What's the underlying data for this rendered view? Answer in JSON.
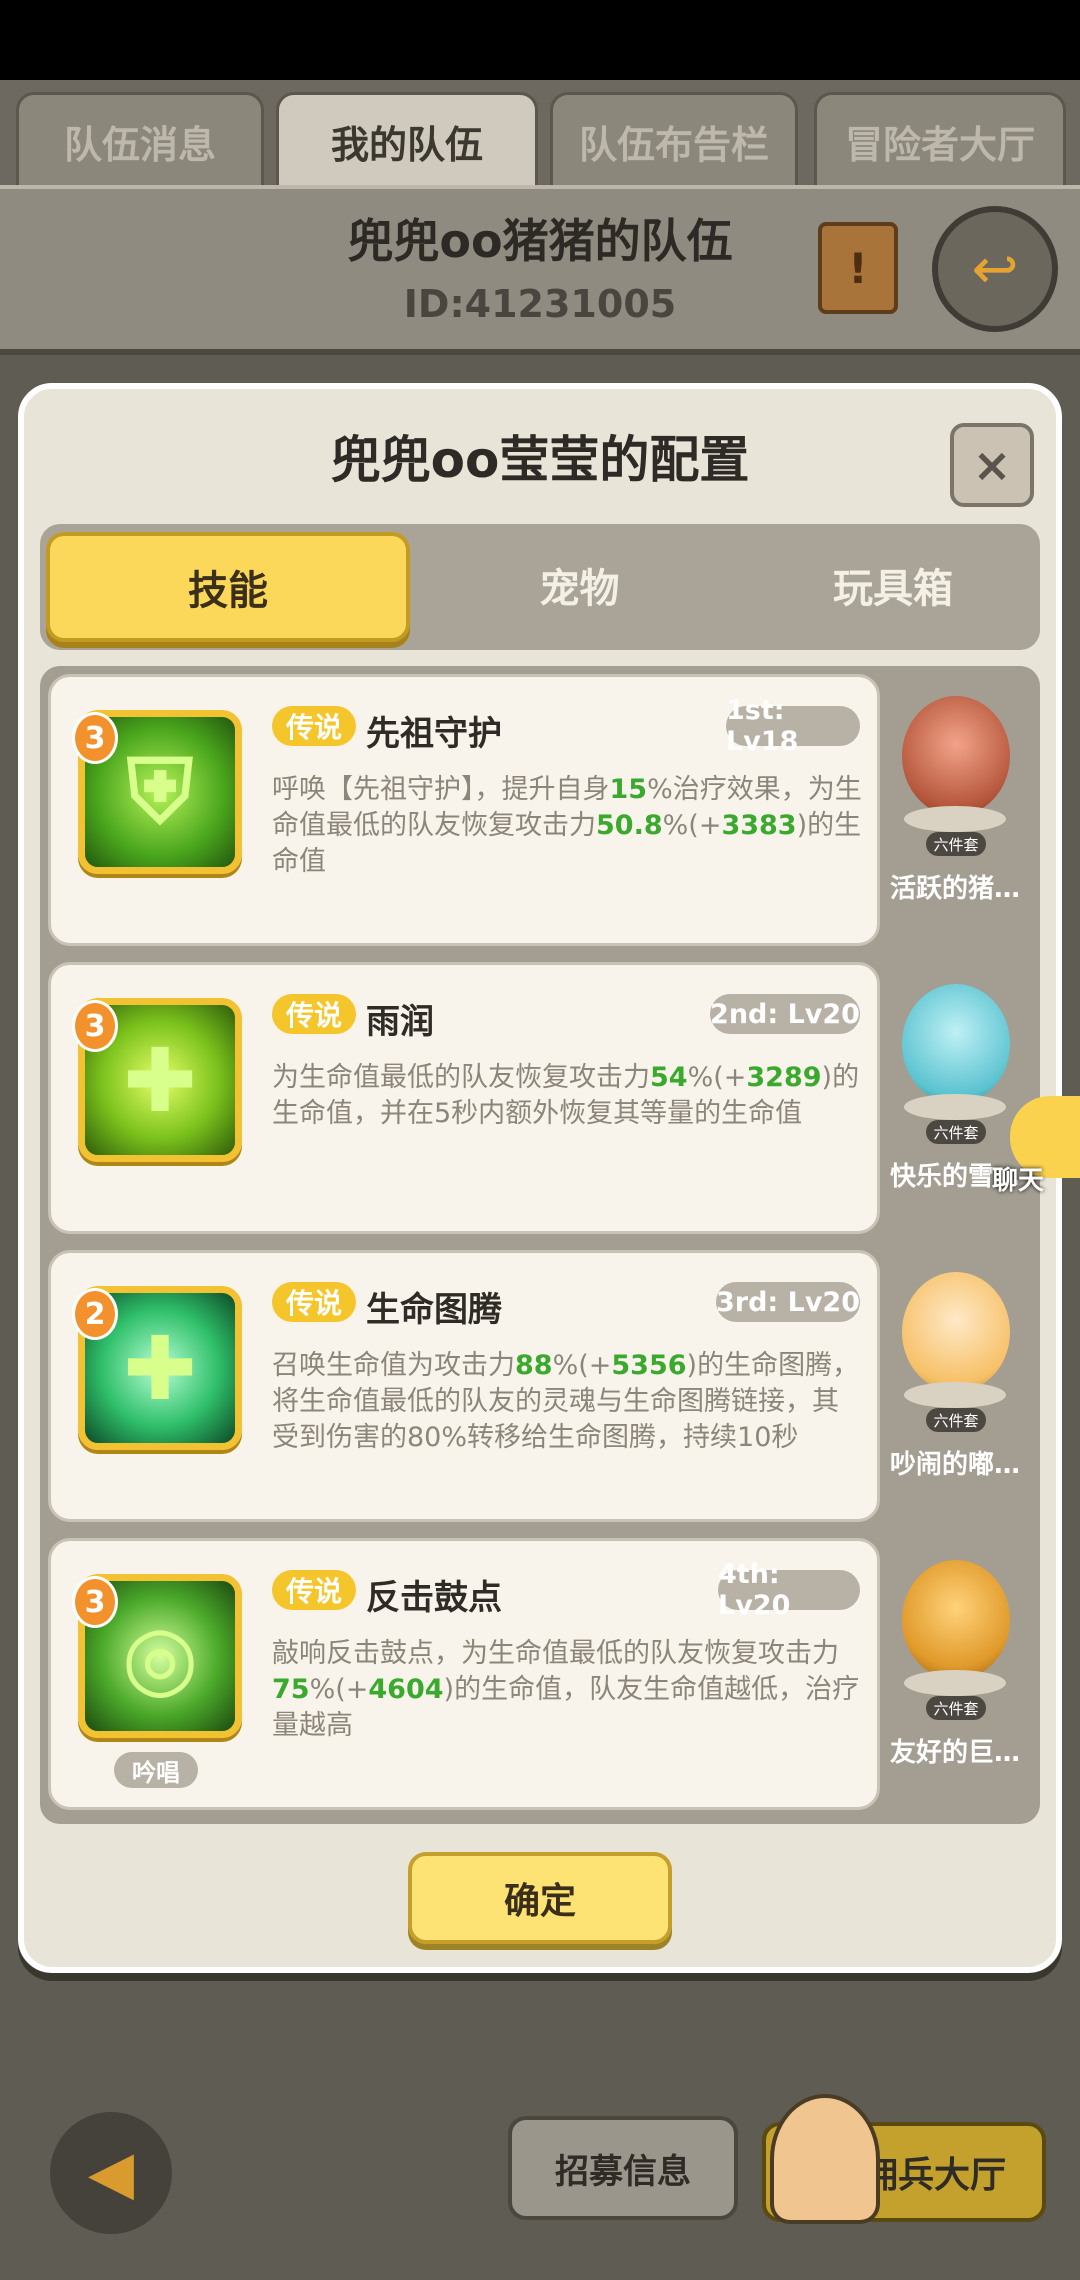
{
  "top_tabs": [
    "队伍消息",
    "我的队伍",
    "队伍布告栏",
    "冒险者大厅"
  ],
  "team": {
    "title": "兜兜oo猪猪的队伍",
    "id": "ID:41231005"
  },
  "panel": {
    "title": "兜兜oo莹莹的配置",
    "close": "×",
    "tabs": [
      "技能",
      "宠物",
      "玩具箱"
    ],
    "confirm": "确定"
  },
  "skills": [
    {
      "level": "3",
      "rarity": "传说",
      "name": "先祖守护",
      "slot": "1st: Lv18",
      "desc": [
        {
          "t": "呼唤【先祖守护】，提升自身",
          "g": false
        },
        {
          "t": "15",
          "g": true
        },
        {
          "t": "%治疗效果，为生命值最低的队友恢复攻击力",
          "g": false
        },
        {
          "t": "50.8",
          "g": true
        },
        {
          "t": "%(+",
          "g": false
        },
        {
          "t": "3383",
          "g": true
        },
        {
          "t": ")的生命值",
          "g": false
        }
      ],
      "pet_name": "活跃的猪…",
      "pet_tag": "六件套"
    },
    {
      "level": "3",
      "rarity": "传说",
      "name": "雨润",
      "slot": "2nd: Lv20",
      "desc": [
        {
          "t": "为生命值最低的队友恢复攻击力",
          "g": false
        },
        {
          "t": "54",
          "g": true
        },
        {
          "t": "%(+",
          "g": false
        },
        {
          "t": "3289",
          "g": true
        },
        {
          "t": ")的生命值，并在5秒内额外恢复其等量的生命值",
          "g": false
        }
      ],
      "pet_name": "快乐的雪…",
      "pet_tag": "六件套"
    },
    {
      "level": "2",
      "rarity": "传说",
      "name": "生命图腾",
      "slot": "3rd: Lv20",
      "desc": [
        {
          "t": "召唤生命值为攻击力",
          "g": false
        },
        {
          "t": "88",
          "g": true
        },
        {
          "t": "%(+",
          "g": false
        },
        {
          "t": "5356",
          "g": true
        },
        {
          "t": ")的生命图腾，将生命值最低的队友的灵魂与生命图腾链接，其受到伤害的80%转移给生命图腾，持续10秒",
          "g": false
        }
      ],
      "pet_name": "吵闹的嘟…",
      "pet_tag": "六件套"
    },
    {
      "level": "3",
      "rarity": "传说",
      "name": "反击鼓点",
      "slot": "4th: Lv20",
      "desc": [
        {
          "t": "敲响反击鼓点，为生命值最低的队友恢复攻击力",
          "g": false
        },
        {
          "t": "75",
          "g": true
        },
        {
          "t": "%(+",
          "g": false
        },
        {
          "t": "4604",
          "g": true
        },
        {
          "t": ")的生命值，队友生命值越低，治疗量越高",
          "g": false
        }
      ],
      "pet_name": "友好的巨…",
      "pet_tag": "六件套",
      "chant": "吟唱"
    }
  ],
  "chat_label": "聊天",
  "bottom": {
    "recruit": "招募信息",
    "mercenary": "佣兵大厅"
  },
  "colors": {
    "accent_yellow": "#fbd75a",
    "highlight_green": "#3aa92e",
    "panel_bg": "#e9e4d8"
  }
}
